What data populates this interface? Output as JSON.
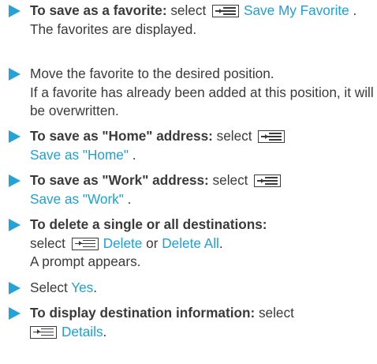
{
  "steps": [
    {
      "bold": "To save as a favorite:",
      "pre": " select",
      "link": "Save My Favorite",
      "post": " .",
      "note": "The favorites are displayed."
    },
    {
      "line1": "Move the favorite to the desired position.",
      "line2": "If a favorite has already been added at this position, it will be overwritten."
    },
    {
      "bold": "To save as \"Home\" address:",
      "pre": " select",
      "link": "Save as \"Home\"",
      "post": " ."
    },
    {
      "bold": "To save as \"Work\" address:",
      "pre": " select",
      "link": "Save as \"Work\"",
      "post": " ."
    },
    {
      "bold": "To delete a single or all destinations:",
      "pre": "select",
      "link1": "Delete",
      "mid": " or ",
      "link2": "Delete All",
      "post": ".",
      "note": "A prompt appears."
    },
    {
      "pre": "Select ",
      "link": "Yes",
      "post": "."
    },
    {
      "bold": "To display destination information:",
      "pre": " select",
      "link": "Details",
      "post": "."
    }
  ],
  "icons": {
    "bullet": "triangle-bullet-icon",
    "menu": "menu-symbol-icon"
  },
  "colors": {
    "bullet": "#23a3d8",
    "link": "#1ea0d6",
    "text": "#3a3a3a"
  }
}
